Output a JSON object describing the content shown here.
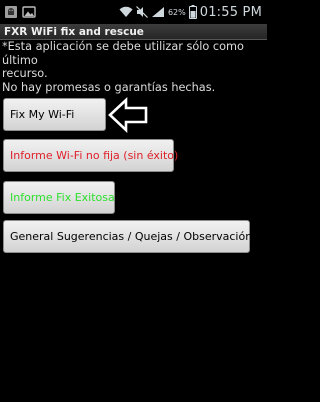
{
  "status_bar": {
    "battery_percent": "62%",
    "time": "01:55 PM",
    "icons": [
      "android-debug-icon",
      "image-icon",
      "wifi-icon",
      "mute-icon",
      "signal-icon",
      "battery-icon"
    ]
  },
  "app": {
    "title": "FXR WiFi fix and rescue"
  },
  "message": {
    "line1": "*Esta aplicación se debe utilizar sólo como último",
    "line2": "recurso.",
    "line3": "No hay promesas o garantías hechas."
  },
  "buttons": {
    "fix_wifi": "Fix My Wi-Fi",
    "report_not_fixed": "Informe Wi-Fi no fija (sin éxito)",
    "report_success": "Informe Fix Exitosa",
    "feedback": "General Sugerencias / Quejas / Observación"
  },
  "colors": {
    "not_fixed_text": "#e0202a",
    "success_text": "#2fe02f",
    "background": "#000000"
  },
  "annotations": {
    "pointer_arrow": "left-arrow-icon"
  }
}
